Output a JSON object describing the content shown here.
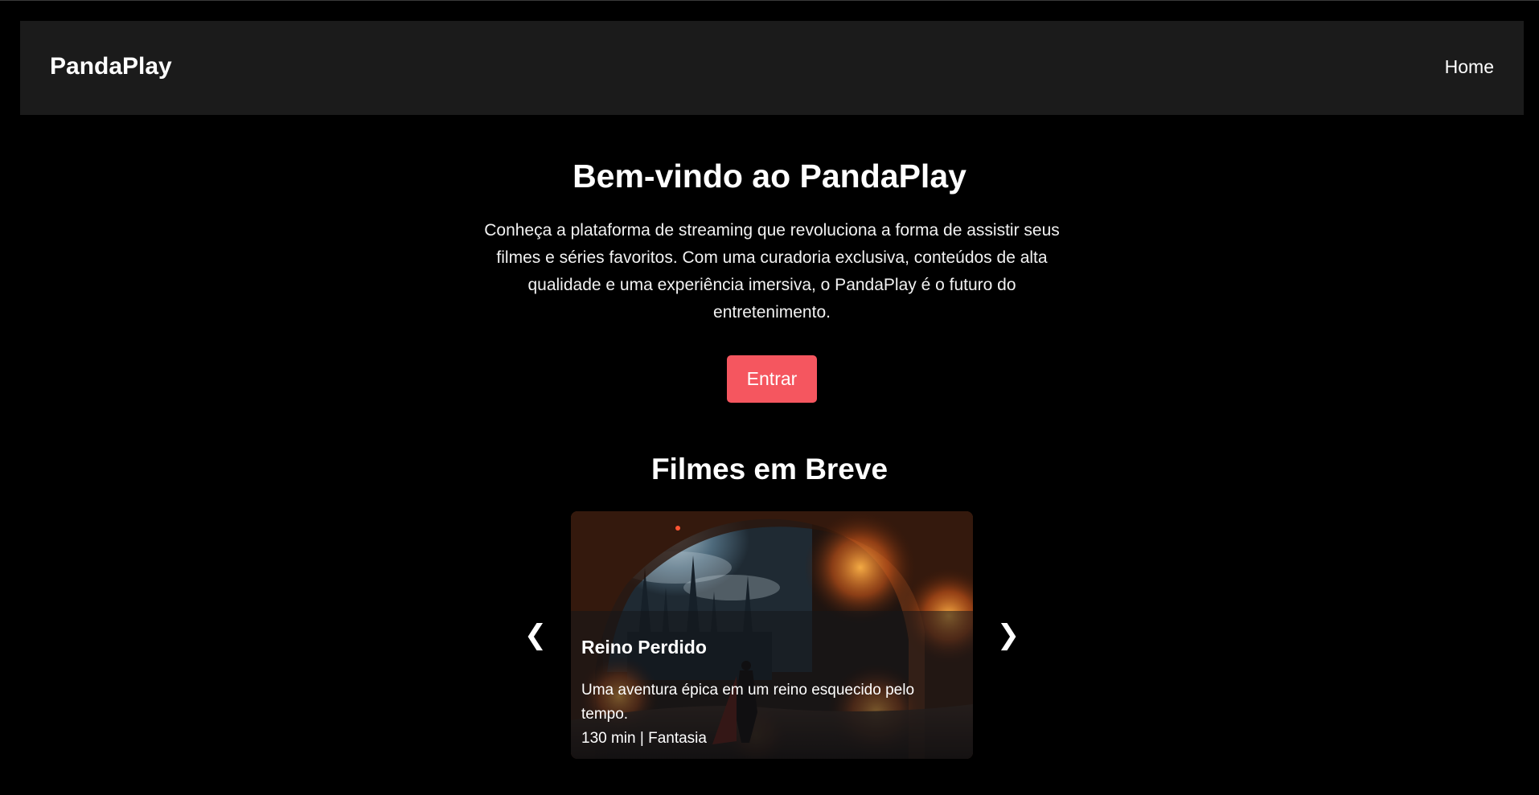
{
  "header": {
    "brand": "PandaPlay",
    "nav_home": "Home"
  },
  "hero": {
    "title": "Bem-vindo ao PandaPlay",
    "description": "Conheça a plataforma de streaming que revoluciona a forma de assistir seus filmes e séries favoritos. Com uma curadoria exclusiva, conteúdos de alta qualidade e uma experiência imersiva, o PandaPlay é o futuro do entretenimento.",
    "cta_label": "Entrar"
  },
  "upcoming": {
    "section_title": "Filmes em Breve",
    "prev_label": "❮",
    "next_label": "❯",
    "movies": [
      {
        "title": "Reino Perdido",
        "description": "Uma aventura épica em um reino esquecido pelo tempo.",
        "meta": "130 min | Fantasia"
      }
    ]
  },
  "colors": {
    "background": "#000000",
    "navbar": "#1b1b1b",
    "accent": "#f5565f",
    "text": "#ffffff"
  }
}
